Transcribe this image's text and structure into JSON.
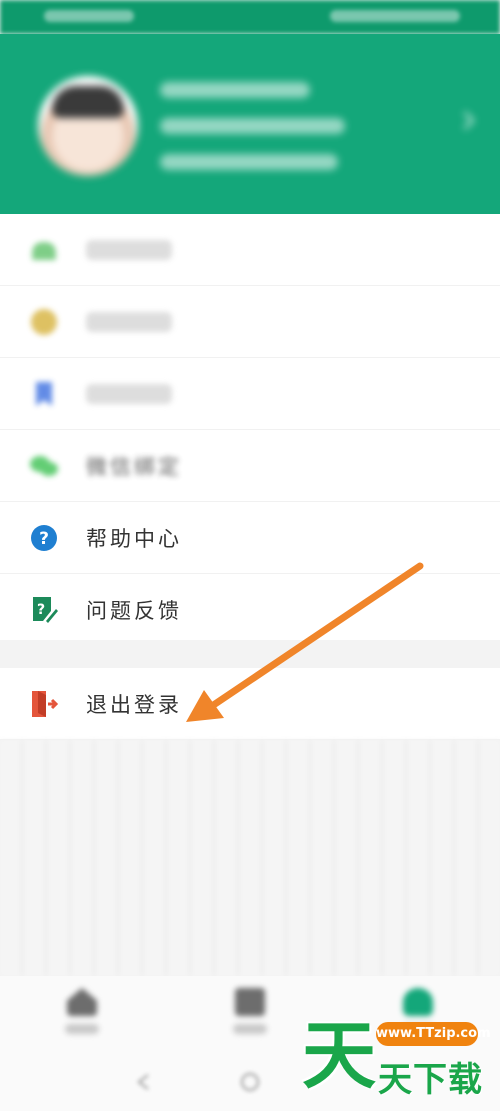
{
  "menu": {
    "items": [
      {
        "label": "",
        "icon": "android-icon",
        "blurred": true
      },
      {
        "label": "",
        "icon": "coin-icon",
        "blurred": true
      },
      {
        "label": "",
        "icon": "bookmark-icon",
        "blurred": true
      },
      {
        "label": "微信绑定",
        "icon": "wechat-icon",
        "blurred": true
      },
      {
        "label": "帮助中心",
        "icon": "help-icon",
        "blurred": false
      },
      {
        "label": "问题反馈",
        "icon": "feedback-icon",
        "blurred": false
      }
    ],
    "logout_label": "退出登录"
  },
  "watermark": {
    "big_char": "天",
    "url": "www.TTzip.com",
    "small_text": "天下载"
  },
  "colors": {
    "header_green": "#14a77a",
    "arrow_orange": "#f0852a",
    "help_blue": "#1f7fd1",
    "feedback_green": "#1c8a5a",
    "logout_red": "#e4553b"
  }
}
